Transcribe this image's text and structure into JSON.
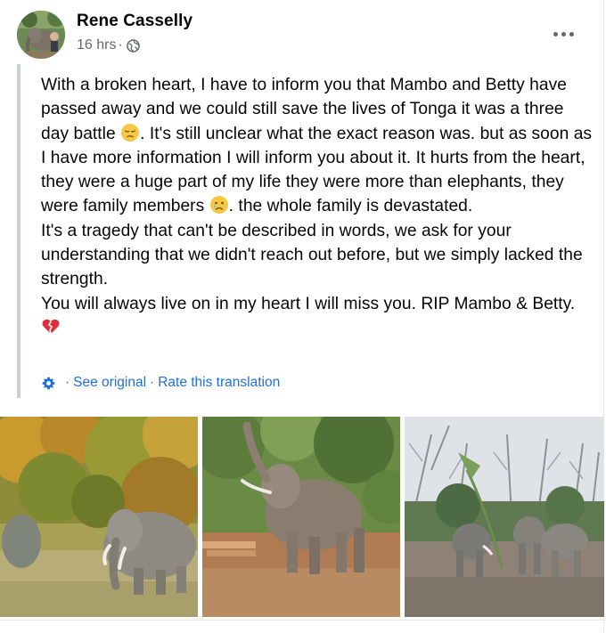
{
  "post": {
    "author": "Rene Casselly",
    "time": "16 hrs",
    "separator": "·",
    "privacy_icon": "globe-icon",
    "more_icon": "more-horizontal-icon",
    "paragraphs": [
      "With a broken heart, I have to inform you that Mambo and Betty have passed away and we could still save the lives of Tonga it was a three day battle",
      ". It's still unclear what the exact reason was. but as soon as I have more information I will inform you about it. It hurts from the heart, they were a huge part of my life they were more than elephants, they were family members",
      ". the whole family is devastated.",
      "It's a tragedy that can't be described in words, we ask for your understanding that we didn't reach out before, but we simply lacked the strength.",
      "You will always live on in my heart I will miss you. RIP Mambo & Betty."
    ],
    "emojis": [
      "pensive-face-emoji",
      "sad-tear-face-emoji",
      "broken-heart-emoji"
    ]
  },
  "translation": {
    "icon": "gear-icon",
    "see_original": "See original",
    "rate": "Rate this translation",
    "separator": "·"
  },
  "photos": [
    {
      "name": "elephant-autumn-trees-photo"
    },
    {
      "name": "elephant-trunk-raised-photo"
    },
    {
      "name": "three-elephants-bare-trees-photo"
    }
  ],
  "colors": {
    "link": "#216fdb",
    "secondary_text": "#65676b",
    "quote_bar": "#ccd0d5"
  }
}
